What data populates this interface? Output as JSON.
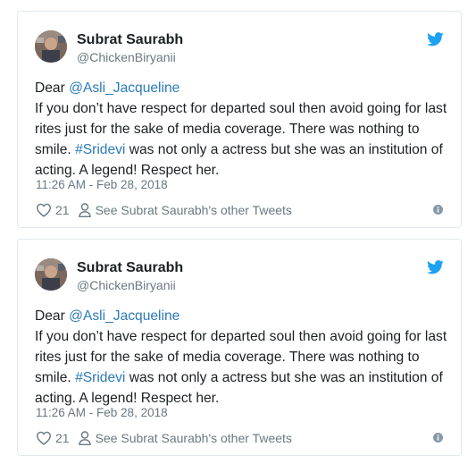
{
  "colors": {
    "accent": "#1da1f2",
    "link": "#2b7bb9",
    "muted": "#697882",
    "text": "#1c2022",
    "border": "#e1e8ed"
  },
  "tweets": [
    {
      "author_name": "Subrat Saurabh",
      "author_handle": "@ChickenBiryanii",
      "text_prefix": "Dear ",
      "mention": "@Asli_Jacqueline",
      "text_middle": "If you don’t have respect for departed soul then avoid going for last rites just for the sake of media coverage. There was nothing to smile. ",
      "hashtag": "#Sridevi",
      "text_suffix": " was not only a actress but she was an institution of acting. A legend! Respect her.",
      "timestamp": "11:26 AM - Feb 28, 2018",
      "likes": "21",
      "other_tweets_label": "See Subrat Saurabh's other Tweets",
      "icons": [
        "avatar",
        "twitter-bird-icon",
        "heart-icon",
        "person-icon",
        "info-icon"
      ]
    },
    {
      "author_name": "Subrat Saurabh",
      "author_handle": "@ChickenBiryanii",
      "text_prefix": "Dear ",
      "mention": "@Asli_Jacqueline",
      "text_middle": "If you don’t have respect for departed soul then avoid going for last rites just for the sake of media coverage. There was nothing to smile. ",
      "hashtag": "#Sridevi",
      "text_suffix": " was not only a actress but she was an institution of acting. A legend! Respect her.",
      "timestamp": "11:26 AM - Feb 28, 2018",
      "likes": "21",
      "other_tweets_label": "See Subrat Saurabh's other Tweets",
      "icons": [
        "avatar",
        "twitter-bird-icon",
        "heart-icon",
        "person-icon",
        "info-icon"
      ]
    }
  ]
}
